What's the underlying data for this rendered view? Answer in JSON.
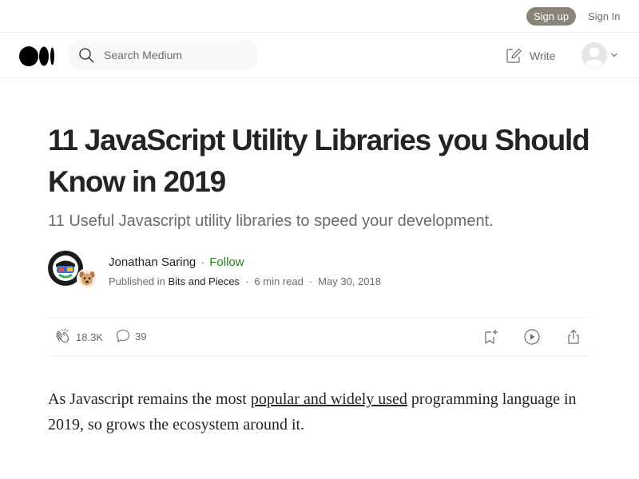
{
  "topbar": {
    "signup_label": "Sign up",
    "signin_label": "Sign In"
  },
  "header": {
    "logo_icon": "medium-logo-icon",
    "search_placeholder": "Search Medium",
    "write_label": "Write"
  },
  "article": {
    "title": "11 JavaScript Utility Libraries you Should Know in 2019",
    "subtitle": "11 Useful Javascript utility libraries to speed your development.",
    "author": {
      "name": "Jonathan Saring",
      "follow_label": "Follow"
    },
    "meta": {
      "published_in_label": "Published in",
      "publication": "Bits and Pieces",
      "read_time": "6 min read",
      "date": "May 30, 2018"
    },
    "actions": {
      "claps": "18.3K",
      "responses": "39"
    },
    "body": {
      "p1_before": "As Javascript remains the most ",
      "p1_link": "popular and widely used",
      "p1_after": " programming language in 2019, so grows the ecosystem around it."
    }
  },
  "colors": {
    "signup_bg": "#8a8378",
    "follow": "#1a8917",
    "text": "#242424",
    "muted": "#6b6b6b"
  }
}
